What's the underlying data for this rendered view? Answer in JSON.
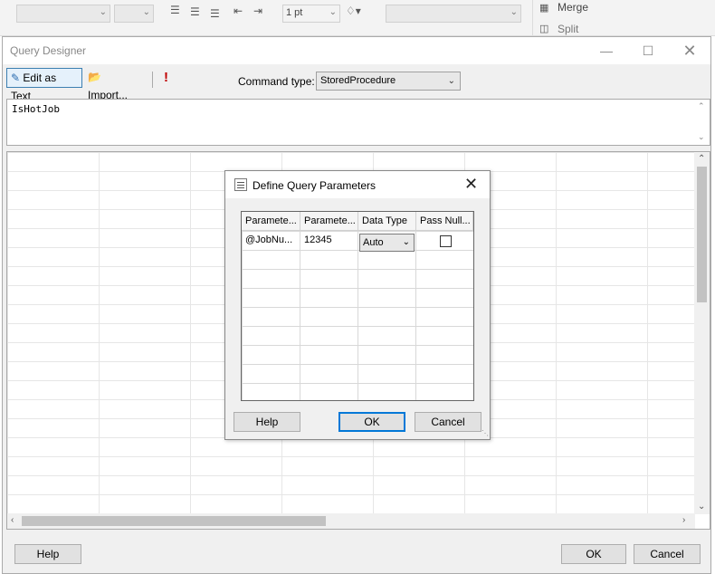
{
  "ribbon": {
    "line_weight": "1 pt",
    "merge_label": "Merge",
    "split_label": "Split"
  },
  "query_designer": {
    "title": "Query Designer",
    "toolbar": {
      "edit_as_text_label": "Edit as Text",
      "import_label": "Import...",
      "run_icon": "exclamation-icon",
      "command_type_label": "Command type:",
      "command_type_value": "StoredProcedure"
    },
    "query_text": "IsHotJob",
    "help_label": "Help",
    "ok_label": "OK",
    "cancel_label": "Cancel"
  },
  "dialog": {
    "title": "Define Query Parameters",
    "columns": [
      "Paramete...",
      "Paramete...",
      "Data Type",
      "Pass  Null..."
    ],
    "rows": [
      {
        "name": "@JobNu...",
        "value": "12345",
        "data_type": "Auto",
        "pass_null": false
      }
    ],
    "help_label": "Help",
    "ok_label": "OK",
    "cancel_label": "Cancel"
  },
  "colors": {
    "accent": "#0078d7",
    "run_icon": "#c00000"
  }
}
